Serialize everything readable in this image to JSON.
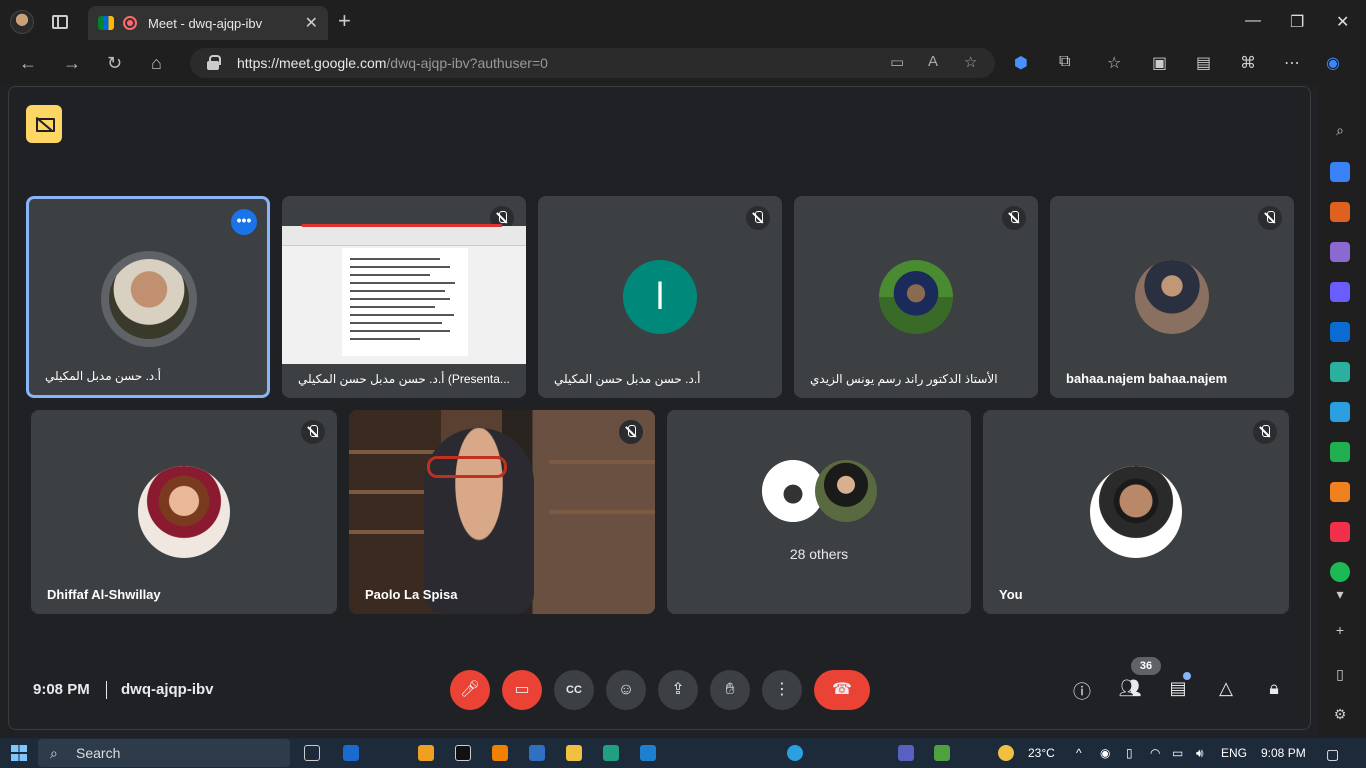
{
  "browser": {
    "tab_title": "Meet - dwq-ajqp-ibv",
    "url_host": "https://meet.google.com",
    "url_path": "/dwq-ajqp-ibv?authuser=0"
  },
  "tiles_row1": [
    {
      "name": "أ.د. حسن مدبل المكيلي",
      "active": true
    },
    {
      "name": "أ.د. حسن مدبل حسن المكيلي (Presenta..."
    },
    {
      "name": "أ.د. حسن مدبل حسن المكيلي",
      "letter": "ا"
    },
    {
      "name": "الأستاذ الدكتور راند رسم يونس الزيدي"
    },
    {
      "name": "bahaa.najem bahaa.najem"
    }
  ],
  "tiles_row2": [
    {
      "name": "Dhiffaf Al-Shwillay"
    },
    {
      "name": "Paolo La Spisa"
    },
    {
      "name": "28 others"
    },
    {
      "name": "You"
    }
  ],
  "controls": {
    "time": "9:08 PM",
    "meeting_code": "dwq-ajqp-ibv",
    "participant_count": "36"
  },
  "taskbar": {
    "search_placeholder": "Search",
    "weather": "23°C",
    "language": "ENG",
    "clock": "9:08 PM"
  }
}
